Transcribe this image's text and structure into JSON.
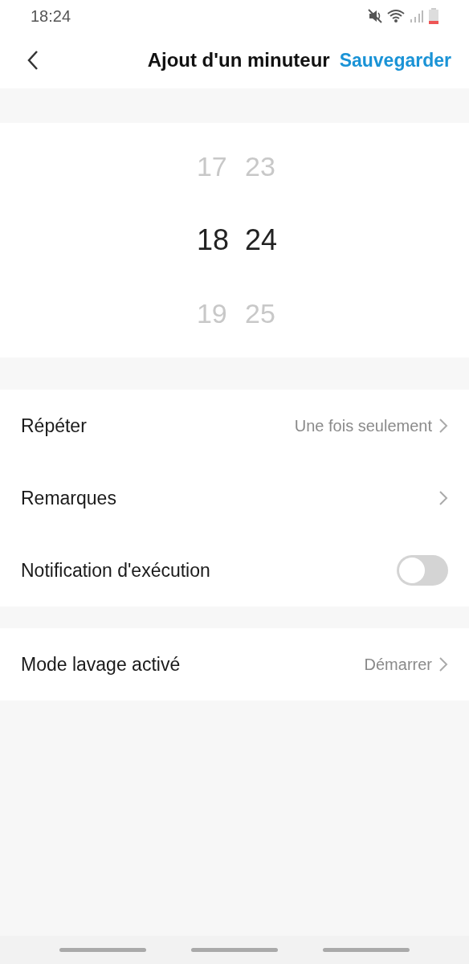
{
  "status_bar": {
    "time": "18:24"
  },
  "header": {
    "title": "Ajout d'un minuteur",
    "action": "Sauvegarder"
  },
  "picker": {
    "columns": [
      {
        "items": [
          {
            "label": "17",
            "selected": false
          },
          {
            "label": "18",
            "selected": true
          },
          {
            "label": "19",
            "selected": false
          }
        ]
      },
      {
        "items": [
          {
            "label": "23",
            "selected": false
          },
          {
            "label": "24",
            "selected": true
          },
          {
            "label": "25",
            "selected": false
          }
        ]
      }
    ]
  },
  "groups": [
    {
      "rows": [
        {
          "kind": "link",
          "label": "Répéter",
          "value": "Une fois seulement"
        },
        {
          "kind": "link",
          "label": "Remarques"
        },
        {
          "kind": "toggle",
          "label": "Notification d'exécution",
          "on": false
        }
      ]
    },
    {
      "rows": [
        {
          "kind": "link",
          "label": "Mode lavage activé",
          "value": "Démarrer"
        }
      ]
    }
  ]
}
